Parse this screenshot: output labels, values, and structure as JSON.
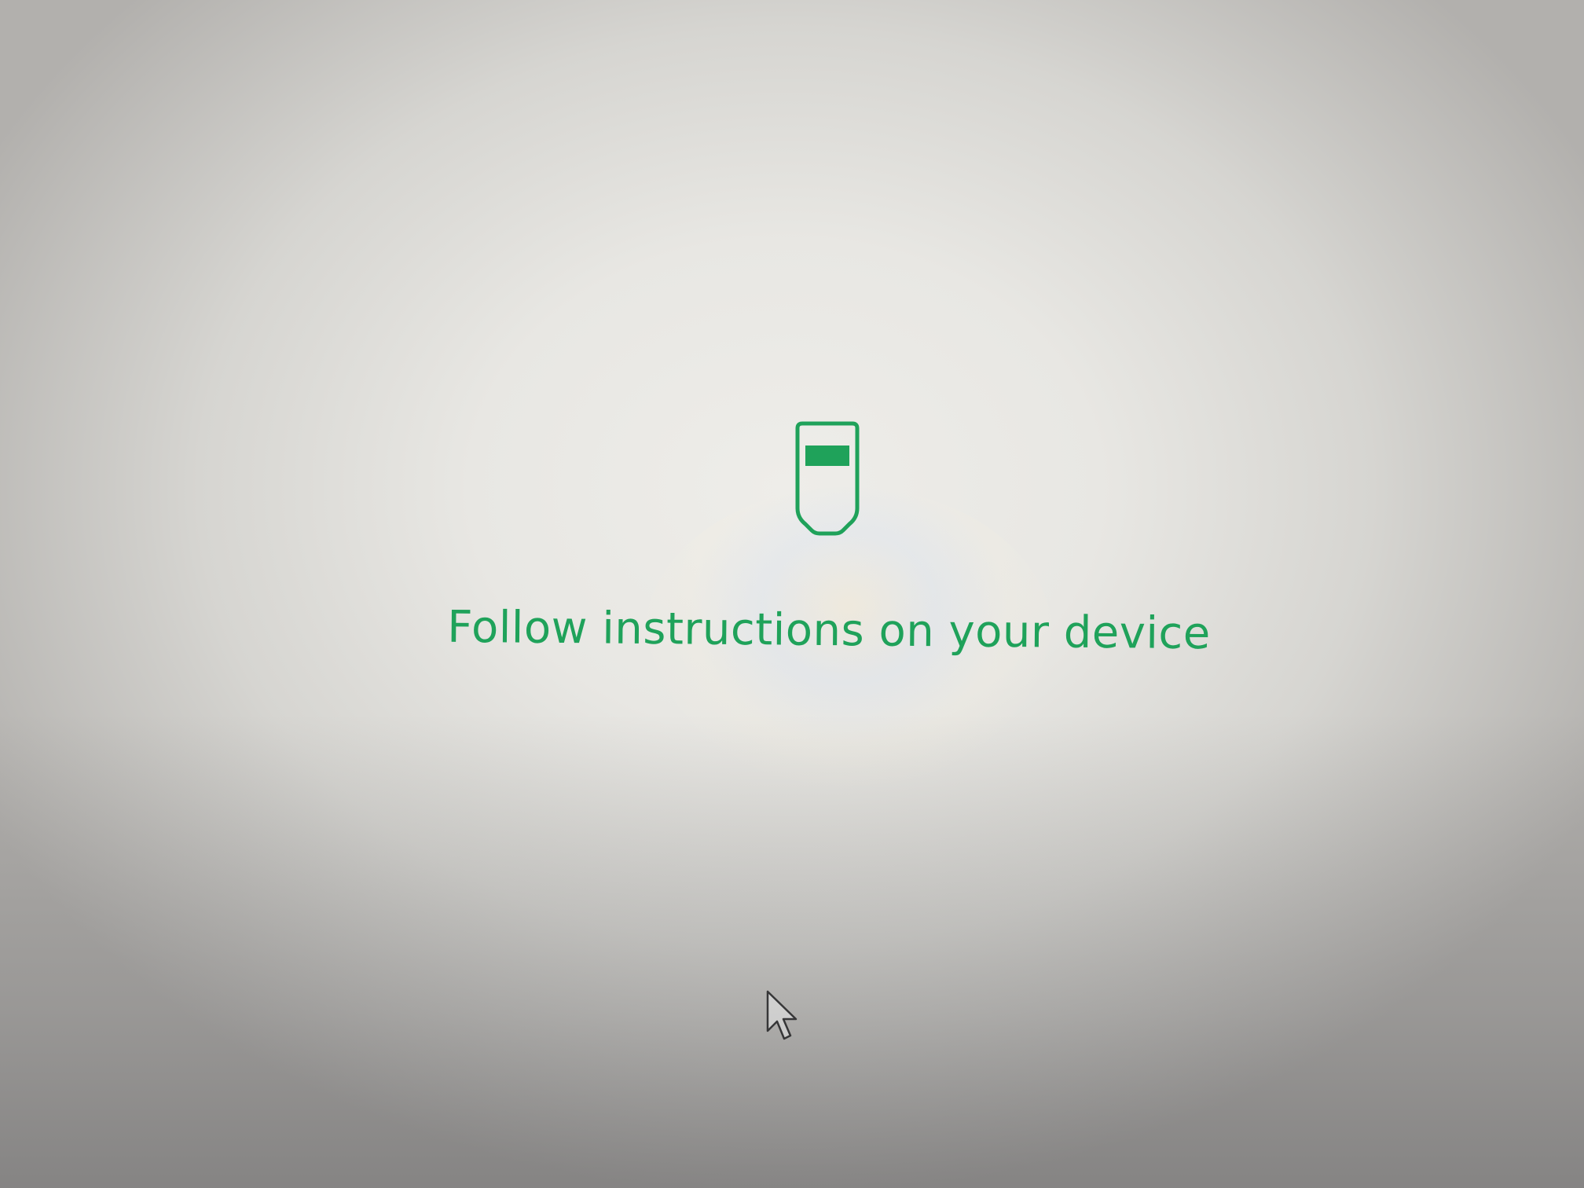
{
  "screen": {
    "message": "Follow instructions on your device",
    "accent_color": "#1fa25a",
    "icon": "hardware-wallet-device-icon",
    "cursor": "mouse-pointer-icon"
  }
}
